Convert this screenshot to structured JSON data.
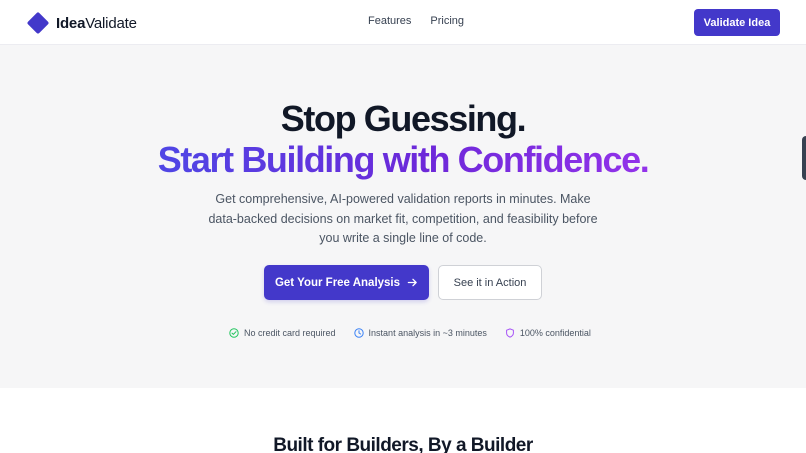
{
  "header": {
    "brand_bold": "Idea",
    "brand_rest": "Validate",
    "logo_icon": "diamond-logo",
    "nav": [
      {
        "label": "Features"
      },
      {
        "label": "Pricing"
      }
    ],
    "cta_label": "Validate Idea"
  },
  "hero": {
    "headline_1": "Stop Guessing.",
    "headline_2": "Start Building with Confidence.",
    "subtitle": "Get comprehensive, AI-powered validation reports in minutes. Make data-backed decisions on market fit, competition, and feasibility before you write a single line of code.",
    "primary_cta": "Get Your Free Analysis",
    "primary_cta_icon": "arrow-right-icon",
    "secondary_cta": "See it in Action",
    "features": [
      {
        "label": "No credit card required",
        "icon": "check-circle-icon",
        "color": "#22c55e"
      },
      {
        "label": "Instant analysis in ~3 minutes",
        "icon": "clock-icon",
        "color": "#3b82f6"
      },
      {
        "label": "100% confidential",
        "icon": "shield-icon",
        "color": "#a855f7"
      }
    ]
  },
  "section": {
    "title": "Built for Builders, By a Builder"
  },
  "colors": {
    "primary": "#4338ca",
    "gradient_start": "#4f46e5",
    "gradient_end": "#9333ea",
    "hero_bg": "#f6f6f7"
  }
}
